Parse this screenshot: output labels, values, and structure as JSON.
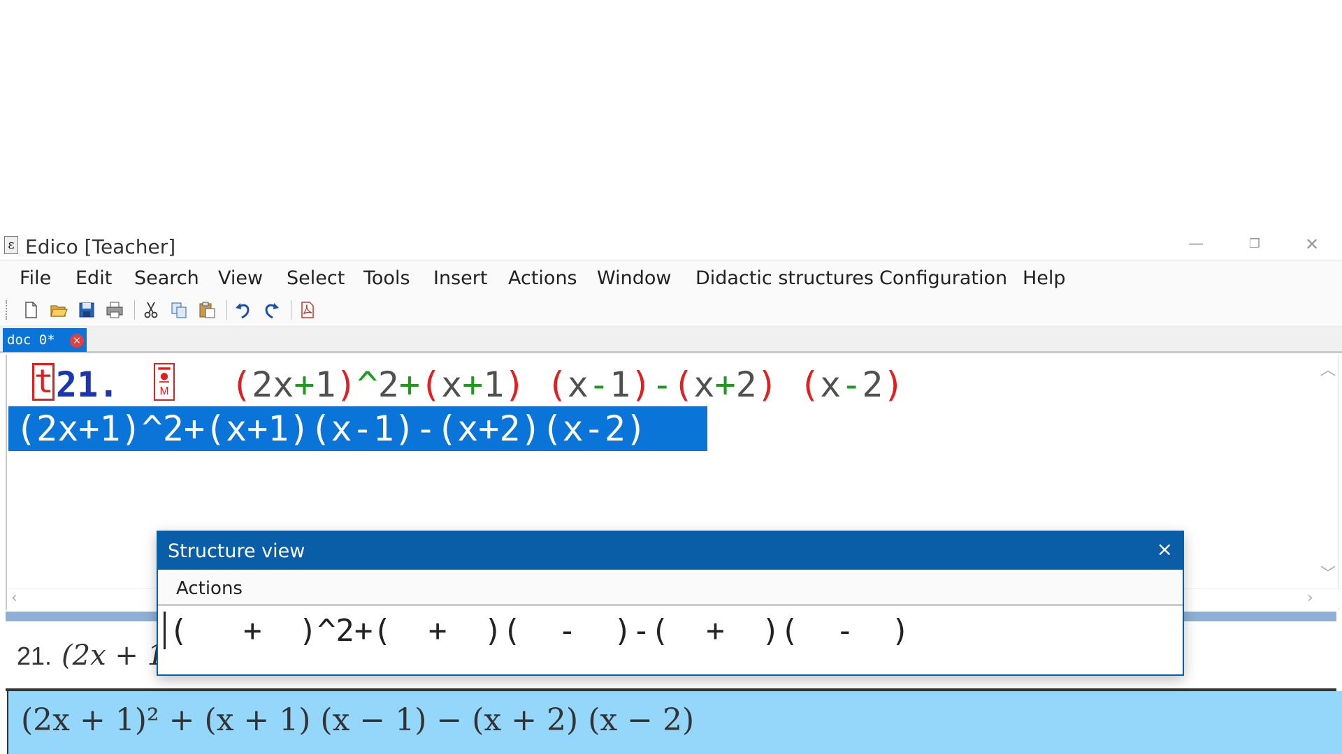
{
  "window": {
    "app_icon_glyph": "ε",
    "title": "Edico  [Teacher]",
    "minimize": "—",
    "maximize": "❐",
    "close": "✕"
  },
  "menu": [
    "File",
    "Edit",
    "Search",
    "View",
    "Select",
    "Tools",
    "Insert",
    "Actions",
    "Window",
    "Didactic structures",
    "Configuration",
    "Help"
  ],
  "toolbar_icons": [
    "new-document-icon",
    "open-folder-icon",
    "save-icon",
    "print-icon",
    "cut-icon",
    "copy-icon",
    "paste-icon",
    "undo-icon",
    "redo-icon",
    "pdf-icon"
  ],
  "tab": {
    "label": "doc 0*",
    "close": "×"
  },
  "editor": {
    "cursor_char": "t",
    "exercise_number": "21.",
    "math_marker_label": "M",
    "expression_tokens": [
      {
        "t": "(",
        "c": "red"
      },
      {
        "t": "2x",
        "c": "gray"
      },
      {
        "t": "+",
        "c": "green"
      },
      {
        "t": "1",
        "c": "gray"
      },
      {
        "t": ")",
        "c": "red"
      },
      {
        "t": "^",
        "c": "green"
      },
      {
        "t": "2",
        "c": "gray"
      },
      {
        "t": "+",
        "c": "green"
      },
      {
        "t": "(",
        "c": "red"
      },
      {
        "t": "x",
        "c": "gray"
      },
      {
        "t": "+",
        "c": "green"
      },
      {
        "t": "1",
        "c": "gray"
      },
      {
        "t": ")",
        "c": "red"
      },
      {
        "t": " ",
        "c": "gray"
      },
      {
        "t": "(",
        "c": "red"
      },
      {
        "t": "x",
        "c": "gray"
      },
      {
        "t": "-",
        "c": "green"
      },
      {
        "t": "1",
        "c": "gray"
      },
      {
        "t": ")",
        "c": "red"
      },
      {
        "t": "-",
        "c": "green"
      },
      {
        "t": "(",
        "c": "red"
      },
      {
        "t": "x",
        "c": "gray"
      },
      {
        "t": "+",
        "c": "green"
      },
      {
        "t": "2",
        "c": "gray"
      },
      {
        "t": ")",
        "c": "red"
      },
      {
        "t": " ",
        "c": "gray"
      },
      {
        "t": "(",
        "c": "red"
      },
      {
        "t": "x",
        "c": "gray"
      },
      {
        "t": "-",
        "c": "green"
      },
      {
        "t": "2",
        "c": "gray"
      },
      {
        "t": ")",
        "c": "red"
      }
    ],
    "selected_line": "(2x+1)^2+(x+1)(x-1)-(x+2)(x-2)"
  },
  "preview": {
    "number": "21.",
    "partial_expression": "(2x + 1"
  },
  "result": {
    "expression": "(2x + 1)² + (x + 1) (x − 1) − (x + 2) (x − 2)"
  },
  "structure_view": {
    "title": "Structure view",
    "close": "×",
    "menu_actions": "Actions",
    "content": "(   +  )^2+(  +  )(  -  )-(  +  )(  -  )"
  },
  "colors": {
    "accent_blue": "#0a74d8",
    "dialog_blue": "#0a5ea8",
    "result_bg": "#95d6fb",
    "red": "#e02020",
    "green": "#1f9a1f"
  }
}
